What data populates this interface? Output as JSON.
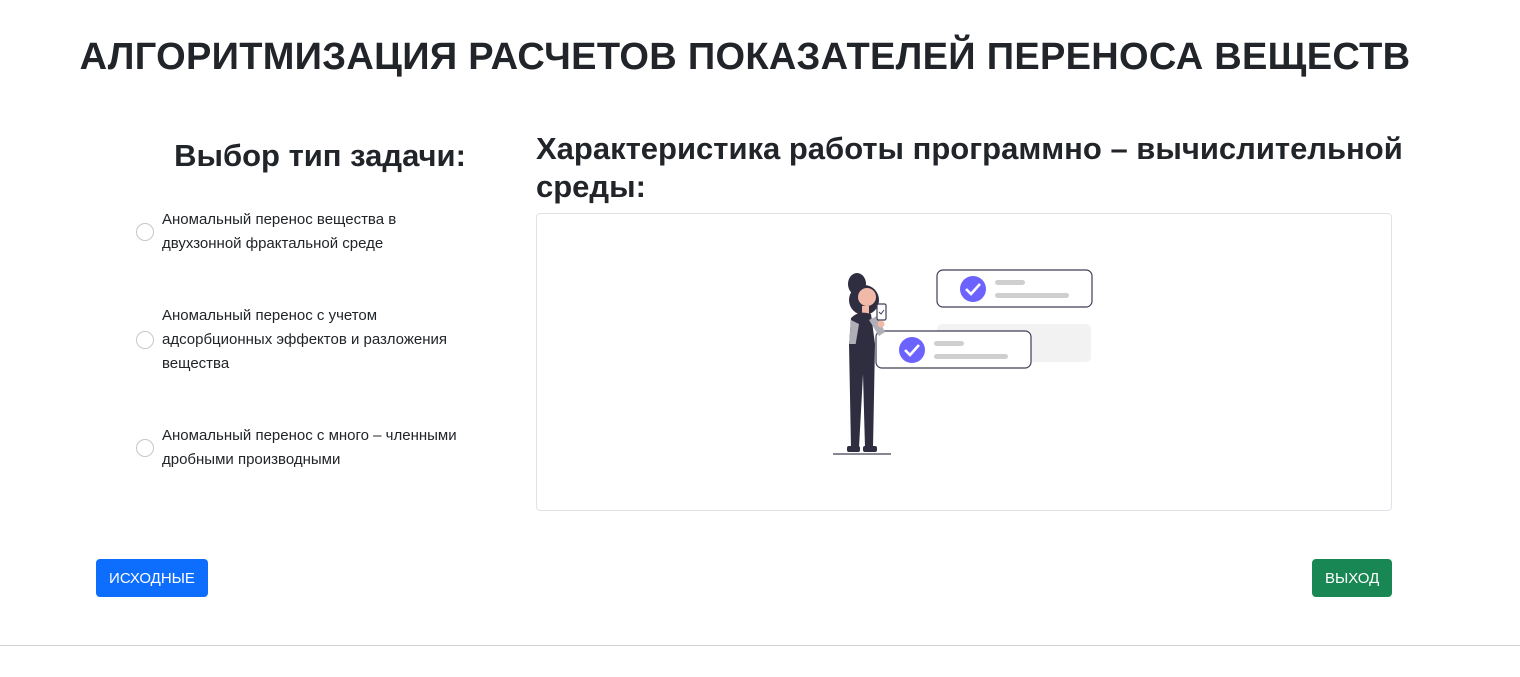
{
  "header": {
    "title": "АЛГОРИТМИЗАЦИЯ РАСЧЕТОВ ПОКАЗАТЕЛЕЙ ПЕРЕНОСА ВЕЩЕСТВ"
  },
  "task_selection": {
    "title": "Выбор тип задачи:",
    "options": [
      {
        "label": "Аномальный перенос вещества в двухзонной фрактальной среде",
        "selected": false
      },
      {
        "label": "Аномальный перенос с учетом адсорбционных эффектов и разложения вещества",
        "selected": false
      },
      {
        "label": "Аномальный перенос с много – членными дробными производными",
        "selected": false
      }
    ]
  },
  "environment": {
    "title": "Характеристика работы программно – вычислительной среды:",
    "illustration": "person-with-checklist-illustration"
  },
  "actions": {
    "source_label": "ИСХОДНЫЕ",
    "exit_label": "ВЫХОД"
  },
  "colors": {
    "primary": "#0d6efd",
    "success": "#198754",
    "accent_check": "#6c63ff",
    "text": "#212529"
  }
}
